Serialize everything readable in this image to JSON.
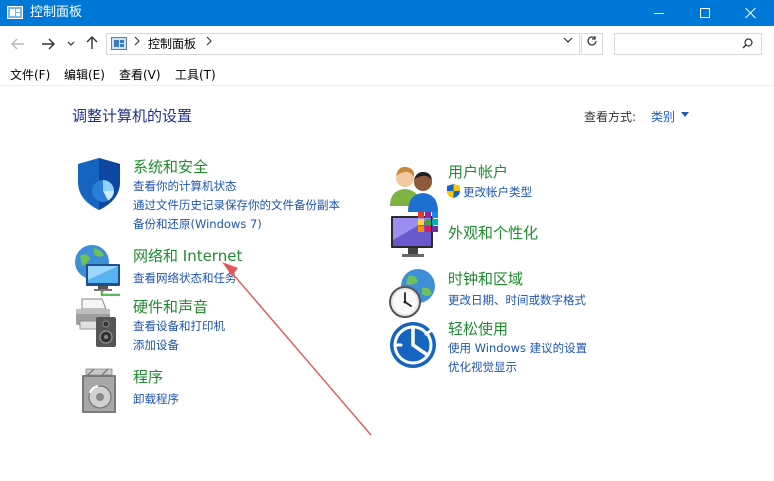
{
  "window": {
    "title": "控制面板",
    "accent_color": "#0078d7"
  },
  "nav": {
    "back_icon": "arrow-left-icon",
    "forward_icon": "arrow-right-icon",
    "up_icon": "arrow-up-icon",
    "address_path": "控制面板",
    "search_placeholder": ""
  },
  "menu": {
    "file": "文件(F)",
    "edit": "编辑(E)",
    "view": "查看(V)",
    "tools": "工具(T)"
  },
  "content": {
    "heading": "调整计算机的设置",
    "view_by_label": "查看方式:",
    "view_by_value": "类别",
    "title_color": "#1f8c2e",
    "link_color": "#1e54b4"
  },
  "categories": {
    "system_security": {
      "title": "系统和安全",
      "links": [
        "查看你的计算机状态",
        "通过文件历史记录保存你的文件备份副本",
        "备份和还原(Windows 7)"
      ]
    },
    "network": {
      "title": "网络和 Internet",
      "links": [
        "查看网络状态和任务"
      ]
    },
    "hardware": {
      "title": "硬件和声音",
      "links": [
        "查看设备和打印机",
        "添加设备"
      ]
    },
    "programs": {
      "title": "程序",
      "links": [
        "卸载程序"
      ]
    },
    "user_accounts": {
      "title": "用户帐户",
      "links": [
        "更改帐户类型"
      ]
    },
    "appearance": {
      "title": "外观和个性化",
      "links": []
    },
    "clock_region": {
      "title": "时钟和区域",
      "links": [
        "更改日期、时间或数字格式"
      ]
    },
    "ease_of_access": {
      "title": "轻松使用",
      "links": [
        "使用 Windows 建议的设置",
        "优化视觉显示"
      ]
    }
  },
  "annotation": {
    "arrow_color": "#e05a5a"
  }
}
